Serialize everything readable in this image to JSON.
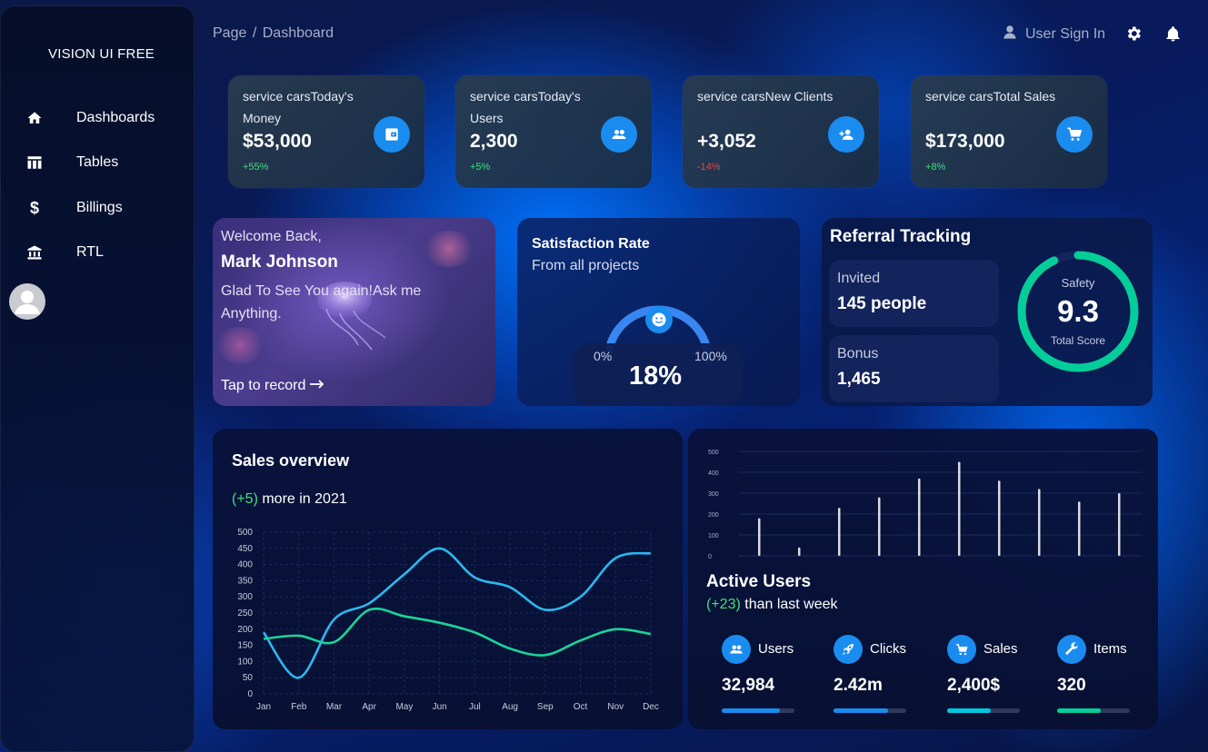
{
  "sidebar": {
    "brand": "VISION UI FREE",
    "items": [
      {
        "label": "Dashboards",
        "icon": "home-icon"
      },
      {
        "label": "Tables",
        "icon": "table-icon"
      },
      {
        "label": "Billings",
        "icon": "dollar-icon"
      },
      {
        "label": "RTL",
        "icon": "bank-icon"
      }
    ]
  },
  "header": {
    "breadcrumb_root": "Page",
    "breadcrumb_sep": "/",
    "breadcrumb_current": "Dashboard",
    "sign_in": "User Sign In"
  },
  "stats": [
    {
      "title": "service carsToday's Money",
      "value": "$53,000",
      "change": "+55%",
      "icon": "wallet-icon"
    },
    {
      "title": "service carsToday's Users",
      "value": "2,300",
      "change": "+5%",
      "icon": "users-icon"
    },
    {
      "title": "service carsNew Clients",
      "value": "+3,052",
      "change": "-14%",
      "icon": "add-user-icon"
    },
    {
      "title": "service carsTotal Sales",
      "value": "$173,000",
      "change": "+8%",
      "icon": "cart-icon"
    }
  ],
  "welcome": {
    "greeting": "Welcome Back,",
    "name": "Mark Johnson",
    "message": "Glad To See You again!Ask me Anything.",
    "action": "Tap to record"
  },
  "satisfaction": {
    "title": "Satisfaction Rate",
    "subtitle": "From all projects",
    "min_label": "0%",
    "max_label": "100%",
    "value_label": "18%",
    "value": 0.18
  },
  "referral": {
    "title": "Referral Tracking",
    "invited_label": "Invited",
    "invited_value": "145 people",
    "bonus_label": "Bonus",
    "bonus_value": "1,465",
    "safety_label": "Safety",
    "score": "9.3",
    "score_label": "Total Score",
    "score_fraction": 0.93,
    "ring_color": "#05cd99"
  },
  "sales_overview": {
    "title": "Sales overview",
    "delta": "(+5)",
    "delta_text": " more in 2021"
  },
  "active_users": {
    "title": "Active Users",
    "delta": "(+23)",
    "delta_text": " than last week",
    "metrics": [
      {
        "label": "Users",
        "value": "32,984",
        "icon": "users-icon",
        "progress": 0.8,
        "color": "#1a8cf0"
      },
      {
        "label": "Clicks",
        "value": "2.42m",
        "icon": "rocket-icon",
        "progress": 0.75,
        "color": "#1a8cf0"
      },
      {
        "label": "Sales",
        "value": "2,400$",
        "icon": "cart-icon",
        "progress": 0.6,
        "color": "#00c8e0"
      },
      {
        "label": "Items",
        "value": "320",
        "icon": "wrench-icon",
        "progress": 0.6,
        "color": "#05cd99"
      }
    ]
  },
  "chart_data": [
    {
      "type": "line",
      "categories": [
        "Jan",
        "Feb",
        "Mar",
        "Apr",
        "May",
        "Jun",
        "Jul",
        "Aug",
        "Sep",
        "Oct",
        "Nov",
        "Dec"
      ],
      "ylim": [
        0,
        500
      ],
      "yticks": [
        "0",
        "50",
        "100",
        "150",
        "200",
        "250",
        "300",
        "350",
        "400",
        "450",
        "500"
      ],
      "grid": true,
      "series": [
        {
          "color": "#2cb8f0",
          "values": [
            190,
            50,
            230,
            280,
            370,
            450,
            360,
            330,
            260,
            300,
            420,
            435
          ]
        },
        {
          "color": "#19d49a",
          "values": [
            170,
            180,
            160,
            260,
            240,
            220,
            190,
            140,
            120,
            165,
            200,
            185
          ]
        }
      ]
    },
    {
      "type": "bar",
      "ylim": [
        0,
        500
      ],
      "yticks": [
        "0",
        "100",
        "200",
        "300",
        "400",
        "500"
      ],
      "grid": true,
      "values": [
        180,
        40,
        230,
        280,
        370,
        450,
        360,
        320,
        260,
        300
      ],
      "color": "#ffffff"
    }
  ]
}
